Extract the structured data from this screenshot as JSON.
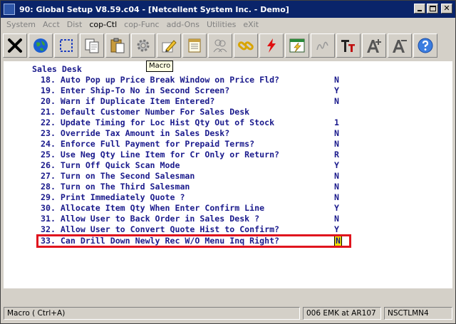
{
  "window": {
    "title": "90: Global Setup V8.59.c04 - [Netcellent System Inc. - Demo]"
  },
  "menu": [
    "System",
    "Acct",
    "Dist",
    "cop-Ctl",
    "cop-Func",
    "add-Ons",
    "Utilities",
    "eXit"
  ],
  "toolbar": {
    "tooltip": "Macro",
    "buttons": [
      "close-x-icon",
      "globe-icon",
      "select-box-icon",
      "copy-icon",
      "paste-icon",
      "gear-icon",
      "macro-pencil-icon",
      "notepad-icon",
      "users-icon",
      "link-icon",
      "lightning-icon",
      "panel-lightning-icon",
      "signature-icon",
      "font-type-icon",
      "font-increase-icon",
      "font-decrease-icon",
      "help-icon"
    ]
  },
  "screen": {
    "section_title": "Sales Desk",
    "items": [
      {
        "label": "18. Auto Pop up Price Break Window on Price Fld?",
        "value": "N"
      },
      {
        "label": "19. Enter Ship-To No in Second Screen?",
        "value": "Y"
      },
      {
        "label": "20. Warn if Duplicate Item Entered?",
        "value": "N"
      },
      {
        "label": "21. Default Customer Number For Sales Desk",
        "value": ""
      },
      {
        "label": "22. Update Timing for Loc Hist Qty Out of Stock",
        "value": "1"
      },
      {
        "label": "23. Override Tax Amount in Sales Desk?",
        "value": "N"
      },
      {
        "label": "24. Enforce Full Payment for Prepaid Terms?",
        "value": "N"
      },
      {
        "label": "25. Use Neg Qty Line Item for Cr Only or Return?",
        "value": "R"
      },
      {
        "label": "26. Turn Off Quick Scan Mode",
        "value": "Y"
      },
      {
        "label": "27. Turn on The Second Salesman",
        "value": "N"
      },
      {
        "label": "28. Turn on The Third Salesman",
        "value": "N"
      },
      {
        "label": "29. Print Immediately Quote ?",
        "value": "N"
      },
      {
        "label": "30. Allocate Item Qty When Enter Confirm Line",
        "value": "Y"
      },
      {
        "label": "31. Allow User to Back Order in Sales Desk ?",
        "value": "N"
      },
      {
        "label": "32. Allow User to Convert Quote Hist to Confirm?",
        "value": "Y"
      },
      {
        "label": "33. Can Drill Down Newly Rec W/O Menu Inq Right?",
        "value": "N"
      }
    ]
  },
  "status": {
    "left": "Macro ( Ctrl+A)",
    "middle": "006 EMK at AR107",
    "right": "NSCTLMN4"
  }
}
